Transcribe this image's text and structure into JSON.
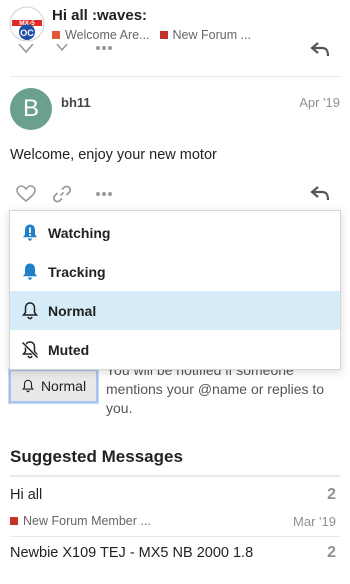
{
  "header": {
    "logo_text_top": "MX-5",
    "logo_text_bottom": "OC",
    "title": "Hi all :waves:",
    "breadcrumbs": [
      {
        "label": "Welcome Are...",
        "color": "#e45735"
      },
      {
        "label": "New Forum ...",
        "color": "#c2332b"
      }
    ]
  },
  "post": {
    "avatar_letter": "B",
    "username": "bh11",
    "date": "Apr '19",
    "body": "Welcome, enjoy your new motor"
  },
  "notifications_menu": {
    "options": [
      {
        "label": "Watching",
        "icon": "bell-alert-icon"
      },
      {
        "label": "Tracking",
        "icon": "bell-icon"
      },
      {
        "label": "Normal",
        "icon": "bell-outline-icon",
        "selected": true
      },
      {
        "label": "Muted",
        "icon": "bell-slash-icon"
      }
    ]
  },
  "tracking": {
    "button_label": "Normal",
    "description": "You will be notified if someone mentions your @name or replies to you."
  },
  "suggested": {
    "heading": "Suggested Messages",
    "items": [
      {
        "title": "Hi all",
        "count": "2",
        "category": "New Forum Member ...",
        "category_color": "#c2332b",
        "date": "Mar '19"
      },
      {
        "title": "Newbie X109 TEJ - MX5 NB 2000 1.8",
        "count": "2"
      }
    ]
  },
  "colors": {
    "accent_blue": "#1e7ec8",
    "selected_bg": "#d6ecf8"
  }
}
